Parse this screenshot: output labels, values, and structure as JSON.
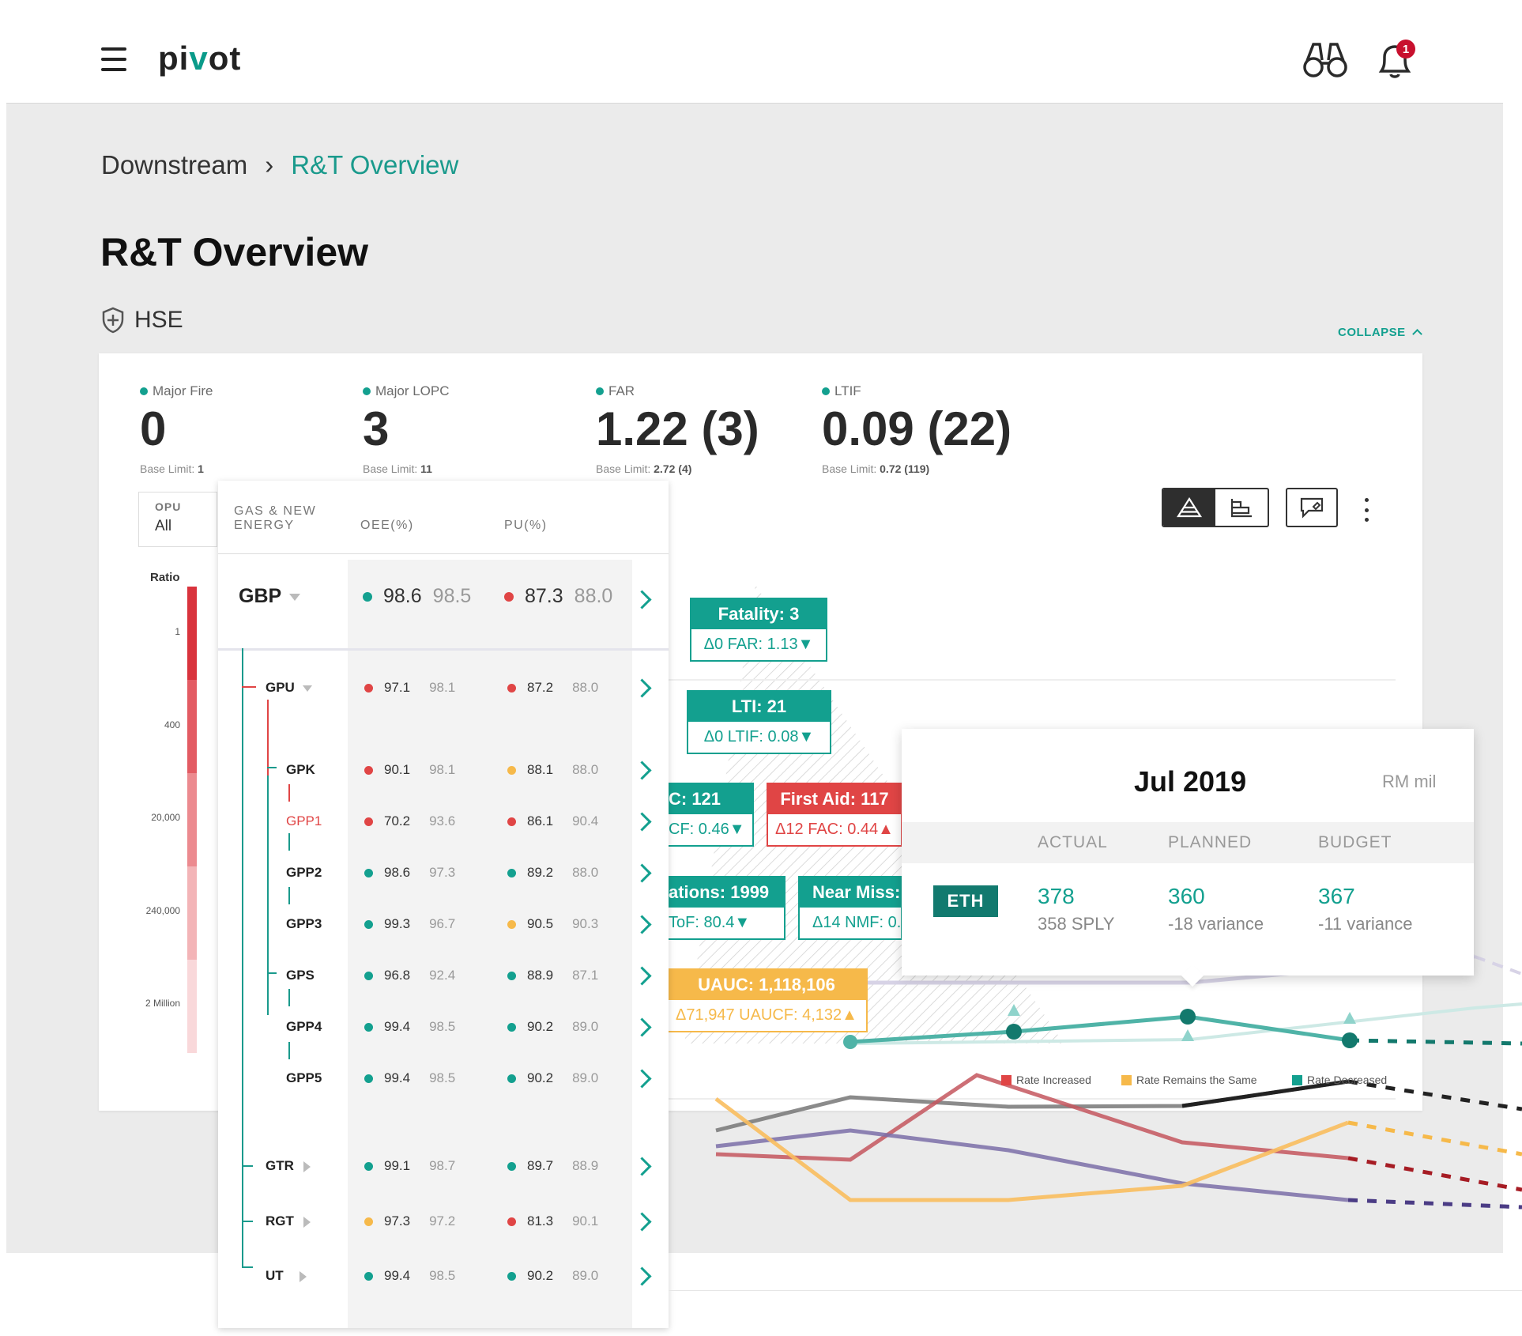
{
  "app": {
    "logo_prefix": "pi",
    "logo_check": "v",
    "logo_suffix": "ot",
    "notification_count": "1"
  },
  "breadcrumb": {
    "parent": "Downstream",
    "current": "R&T Overview"
  },
  "page_title": "R&T Overview",
  "section": {
    "title": "HSE",
    "collapse_label": "COLLAPSE"
  },
  "kpis": [
    {
      "label": "Major Fire",
      "value": "0",
      "base_prefix": "Base Limit:",
      "base_value": "1"
    },
    {
      "label": "Major LOPC",
      "value": "3",
      "base_prefix": "Base Limit:",
      "base_value": "11"
    },
    {
      "label": "FAR",
      "value": "1.22 (3)",
      "base_prefix": "Base Limit:",
      "base_value": "2.72 (4)"
    },
    {
      "label": "LTIF",
      "value": "0.09 (22)",
      "base_prefix": "Base Limit:",
      "base_value": "0.72 (119)"
    }
  ],
  "opu": {
    "label": "OPU",
    "value": "All"
  },
  "ratio_axis": {
    "label": "Ratio",
    "ticks": [
      "1",
      "400",
      "20,000",
      "240,000",
      "2 Million"
    ]
  },
  "table": {
    "headers": {
      "group": "GAS & NEW ENERGY",
      "oee": "OEE(%)",
      "pu": "PU(%)"
    },
    "top": {
      "name": "GBP",
      "oee_actual": "98.6",
      "oee_target": "98.5",
      "oee_status": "#13a08f",
      "pu_actual": "87.3",
      "pu_target": "88.0",
      "pu_status": "#e04545"
    },
    "rows": [
      {
        "name": "GPU",
        "oee_actual": "97.1",
        "oee_target": "98.1",
        "oee_status": "#e04545",
        "pu_actual": "87.2",
        "pu_target": "88.0",
        "pu_status": "#e04545"
      },
      {
        "name": "GPK",
        "oee_actual": "90.1",
        "oee_target": "98.1",
        "oee_status": "#e04545",
        "pu_actual": "88.1",
        "pu_target": "88.0",
        "pu_status": "#f6b94a"
      },
      {
        "name": "GPP1",
        "oee_actual": "70.2",
        "oee_target": "93.6",
        "oee_status": "#e04545",
        "pu_actual": "86.1",
        "pu_target": "90.4",
        "pu_status": "#e04545"
      },
      {
        "name": "GPP2",
        "oee_actual": "98.6",
        "oee_target": "97.3",
        "oee_status": "#13a08f",
        "pu_actual": "89.2",
        "pu_target": "88.0",
        "pu_status": "#13a08f"
      },
      {
        "name": "GPP3",
        "oee_actual": "99.3",
        "oee_target": "96.7",
        "oee_status": "#13a08f",
        "pu_actual": "90.5",
        "pu_target": "90.3",
        "pu_status": "#f6b94a"
      },
      {
        "name": "GPS",
        "oee_actual": "96.8",
        "oee_target": "92.4",
        "oee_status": "#13a08f",
        "pu_actual": "88.9",
        "pu_target": "87.1",
        "pu_status": "#13a08f"
      },
      {
        "name": "GPP4",
        "oee_actual": "99.4",
        "oee_target": "98.5",
        "oee_status": "#13a08f",
        "pu_actual": "90.2",
        "pu_target": "89.0",
        "pu_status": "#13a08f"
      },
      {
        "name": "GPP5",
        "oee_actual": "99.4",
        "oee_target": "98.5",
        "oee_status": "#13a08f",
        "pu_actual": "90.2",
        "pu_target": "89.0",
        "pu_status": "#13a08f"
      },
      {
        "name": "GTR",
        "oee_actual": "99.1",
        "oee_target": "98.7",
        "oee_status": "#13a08f",
        "pu_actual": "89.7",
        "pu_target": "88.9",
        "pu_status": "#13a08f"
      },
      {
        "name": "RGT",
        "oee_actual": "97.3",
        "oee_target": "97.2",
        "oee_status": "#f6b94a",
        "pu_actual": "81.3",
        "pu_target": "90.1",
        "pu_status": "#e04545"
      },
      {
        "name": "UT",
        "oee_actual": "99.4",
        "oee_target": "98.5",
        "oee_status": "#13a08f",
        "pu_actual": "90.2",
        "pu_target": "89.0",
        "pu_status": "#13a08f"
      }
    ]
  },
  "pyramid_tags": {
    "fatality": {
      "title": "Fatality: 3",
      "detail": "Δ0  FAR: 1.13▼"
    },
    "lti": {
      "title": "LTI: 21",
      "detail": "Δ0  LTIF: 0.08▼"
    },
    "rc": {
      "title": "C: 121",
      "detail": "CF: 0.46▼"
    },
    "first_aid": {
      "title": "First Aid: 117",
      "detail": "Δ12  FAC: 0.44▲"
    },
    "observations": {
      "title": "ations: 1999",
      "detail": "ToF: 80.4▼"
    },
    "near_miss": {
      "title": "Near Miss:",
      "detail": "Δ14  NMF: 0."
    },
    "uauc": {
      "title": "UAUC: 1,118,106",
      "detail": "Δ71,947  UAUCF: 4,132▲"
    }
  },
  "tooltip": {
    "title": "Jul 2019",
    "unit": "RM mil",
    "headers": [
      "ACTUAL",
      "PLANNED",
      "BUDGET"
    ],
    "row_label": "ETH",
    "actual": "378",
    "actual_sub": "358 SPLY",
    "planned": "360",
    "planned_sub": "-18 variance",
    "budget": "367",
    "budget_sub": "-11 variance"
  },
  "legend": [
    {
      "label": "Rate Increased",
      "color": "#e04545"
    },
    {
      "label": "Rate Remains the Same",
      "color": "#f6b94a"
    },
    {
      "label": "Rate Decreased",
      "color": "#13a08f"
    }
  ],
  "colors": {
    "accent": "#13a08f",
    "danger": "#e04545",
    "warning": "#f6b94a",
    "dark_accent": "#127a6f"
  }
}
